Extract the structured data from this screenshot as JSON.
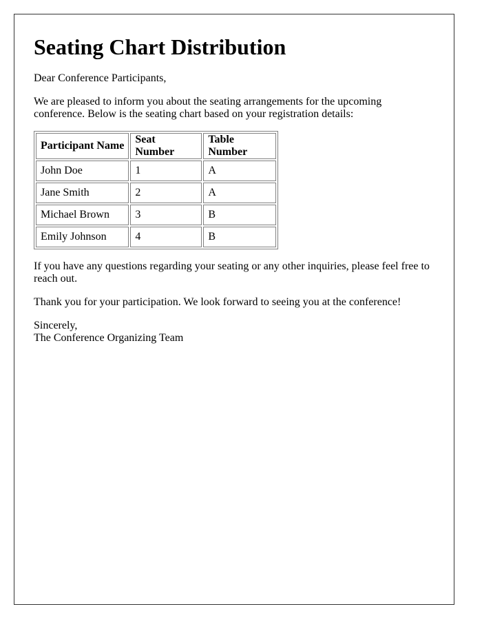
{
  "document": {
    "title": "Seating Chart Distribution",
    "greeting": "Dear Conference Participants,",
    "intro": "We are pleased to inform you about the seating arrangements for the upcoming conference. Below is the seating chart based on your registration details:",
    "table": {
      "headers": [
        "Participant Name",
        "Seat Number",
        "Table Number"
      ],
      "rows": [
        [
          "John Doe",
          "1",
          "A"
        ],
        [
          "Jane Smith",
          "2",
          "A"
        ],
        [
          "Michael Brown",
          "3",
          "B"
        ],
        [
          "Emily Johnson",
          "4",
          "B"
        ]
      ]
    },
    "followup": "If you have any questions regarding your seating or any other inquiries, please feel free to reach out.",
    "thanks": "Thank you for your participation. We look forward to seeing you at the conference!",
    "closing": "Sincerely,",
    "signature": "The Conference Organizing Team"
  }
}
